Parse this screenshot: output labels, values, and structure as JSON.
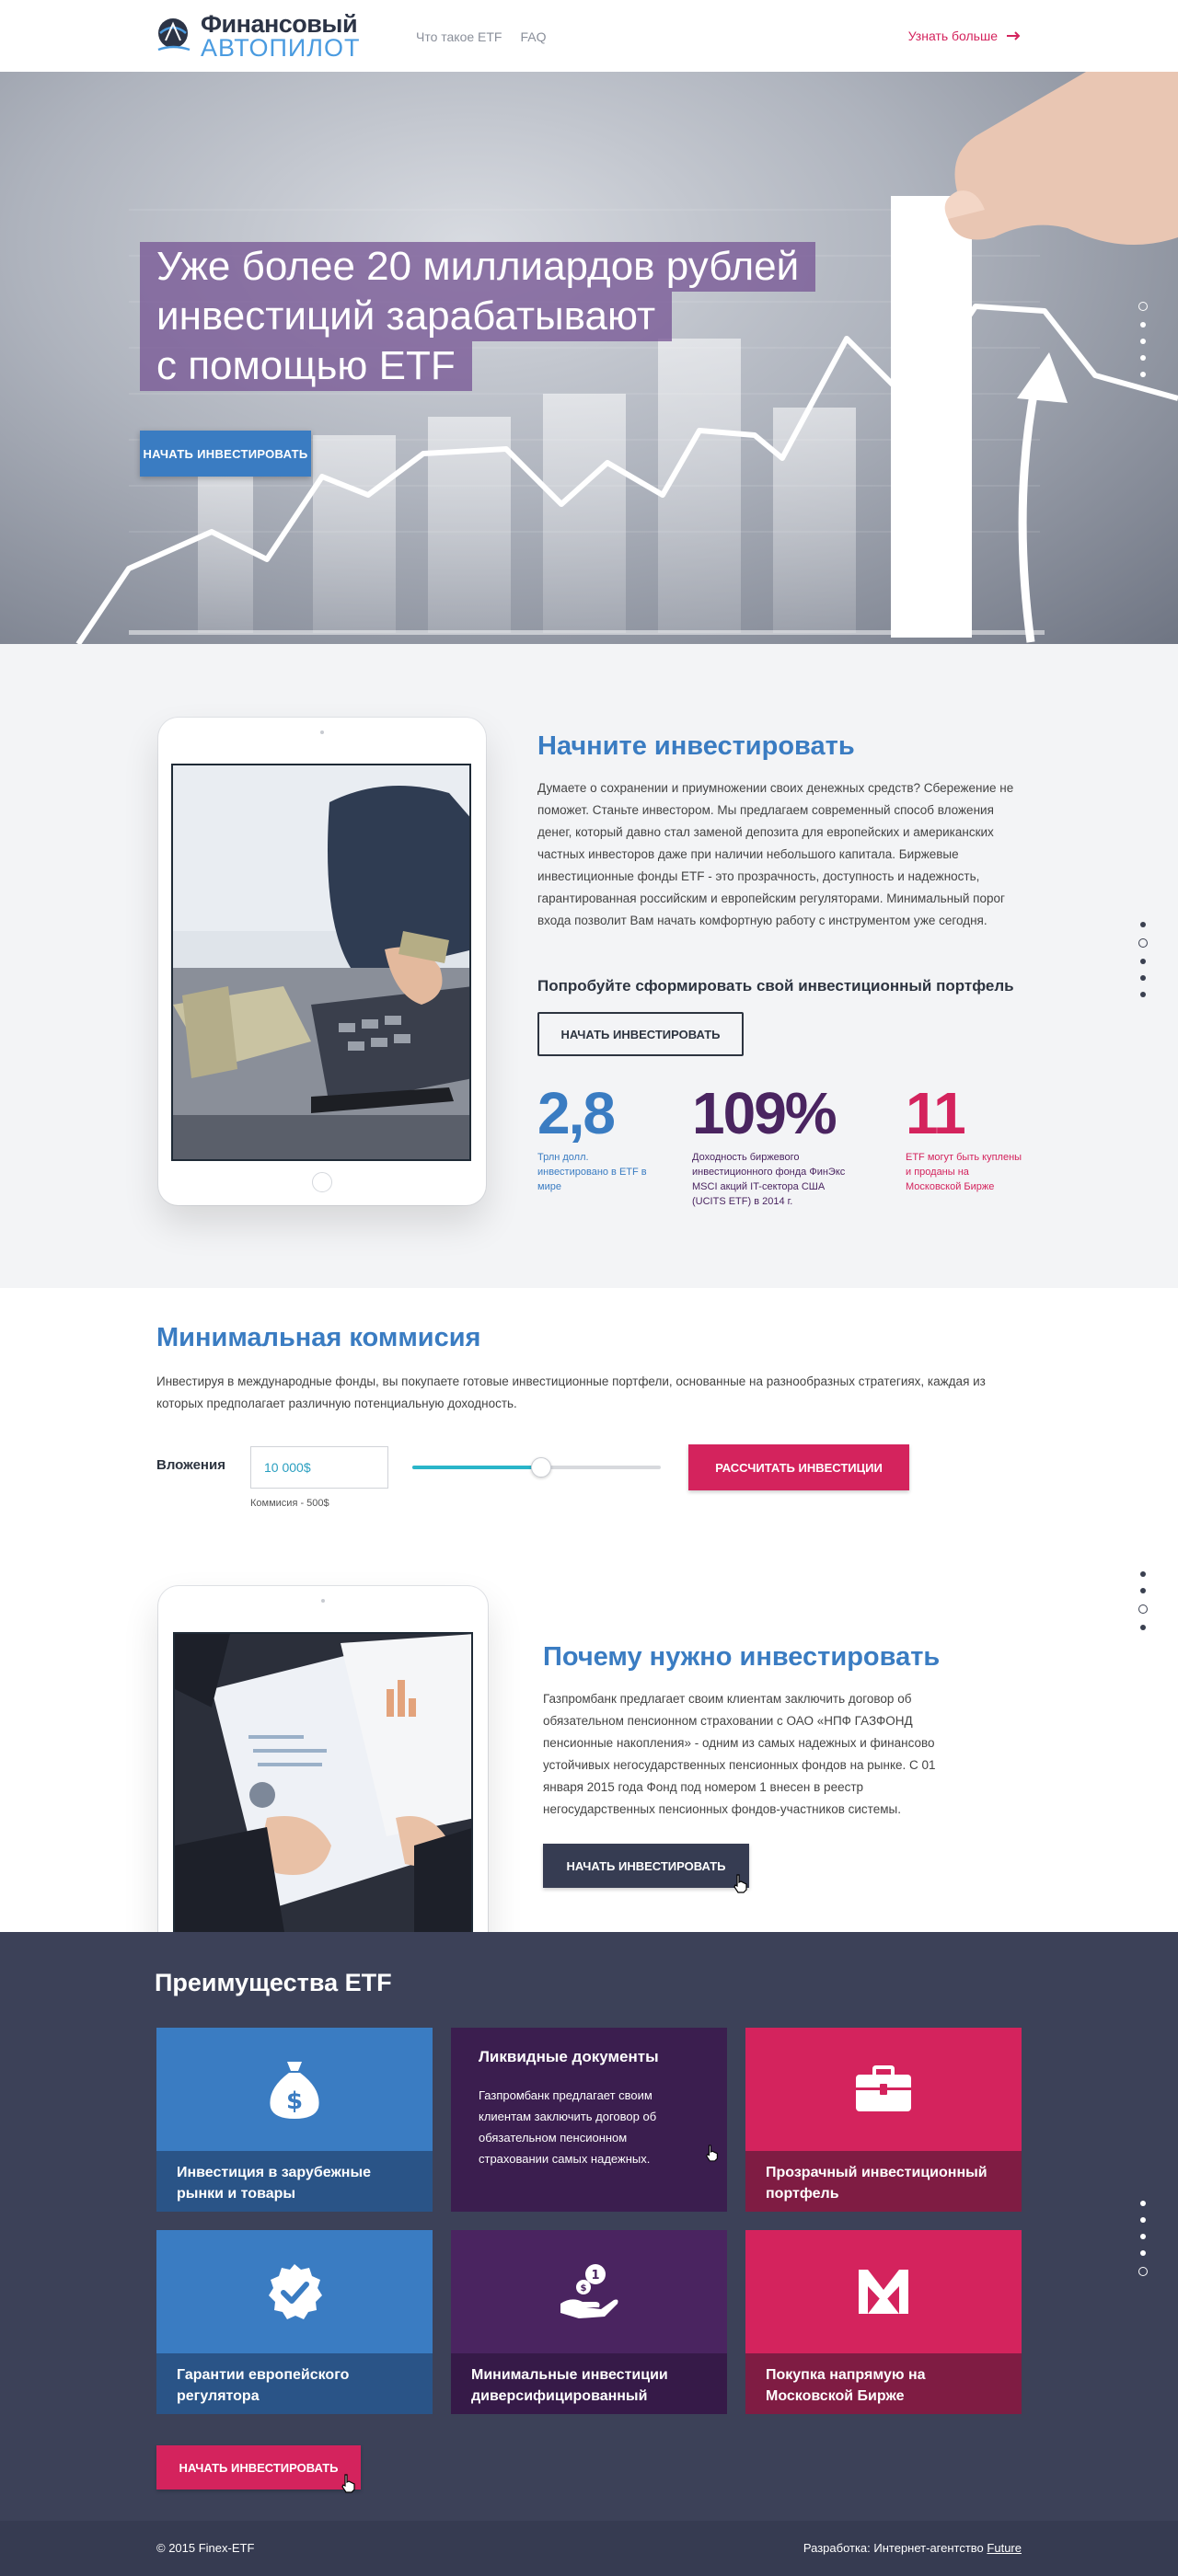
{
  "header": {
    "logo_line1": "Финансовый",
    "logo_line2": "АВТОПИЛОТ",
    "nav": [
      "Что такое ETF",
      "FAQ"
    ],
    "learn_more": "Узнать больше"
  },
  "hero": {
    "title_lines": [
      "Уже более 20 миллиардов рублей",
      "инвестиций зарабатывают",
      "с помощью ETF"
    ],
    "cta": "НАЧАТЬ ИНВЕСТИРОВАТЬ"
  },
  "invest": {
    "title": "Начните инвестировать",
    "paragraph": "Думаете о сохранении и приумножении своих денежных средств? Сбережение не поможет. Станьте инвестором. Мы предлагаем современный способ вложения денег, который давно стал заменой депозита для европейских и американских частных инвесторов даже при наличии  небольшого капитала. Биржевые инвестиционные фонды ETF - это прозрачность, доступность и надежность, гарантированная российским и европейским регуляторами. Минимальный порог входа позволит Вам начать комфортную работу с инструментом уже сегодня.",
    "subtitle": "Попробуйте сформировать свой инвестиционный портфель",
    "cta": "НАЧАТЬ ИНВЕСТИРОВАТЬ",
    "stats": [
      {
        "value": "2,8",
        "text": "Трлн долл. инвестировано в ETF в мире",
        "color": "#3a7cc2"
      },
      {
        "value": "109%",
        "text": "Доходность биржевого инвестиционного фонда ФинЭкс MSCI акций IT-сектора США (UCITS ETF) в 2014 г.",
        "color": "#4a2460"
      },
      {
        "value": "11",
        "text": "ETF могут быть куплены и проданы на Московской Бирже",
        "color": "#d4235d"
      }
    ]
  },
  "commission": {
    "title": "Минимальная коммисия",
    "paragraph": "Инвестируя в международные фонды, вы покупаете готовые инвестиционные портфели, основанные на разнообразных стратегиях, каждая из которых предполагает различную потенциальную доходность.",
    "label": "Вложения",
    "input_value": "10 000$",
    "note": "Коммисия - 500$",
    "slider_level": 0.52,
    "cta": "РАССЧИТАТЬ ИНВЕСТИЦИИ"
  },
  "why": {
    "title": "Почему нужно инвестировать",
    "paragraph": "Газпромбанк предлагает своим клиентам заключить договор об обязательном пенсионном страховании с ОАО «НПФ ГАЗФОНД пенсионные накопления» - одним из самых надежных и финансово устойчивых негосударственных пенсионных фондов на рынке. С 01 января 2015 года Фонд под номером 1 внесен в реестр негосударственных пенсионных фондов-участников системы.",
    "cta": "НАЧАТЬ ИНВЕСТИРОВАТЬ"
  },
  "advantages": {
    "title": "Преимущества ETF",
    "cards": [
      {
        "label": "Инвестиция в зарубежные рынки и товары",
        "icon": "money-bag-icon",
        "color": "#3a7cc2",
        "cap_color": "#2a5487"
      },
      {
        "label": "Ликвидные документы",
        "text": "Газпромбанк предлагает своим клиентам заключить договор об обязательном пенсионном страховании самых надежных.",
        "color": "#3b1e4f"
      },
      {
        "label": "Прозрачный инвестиционный портфель",
        "icon": "briefcase-icon",
        "color": "#d4235d",
        "cap_color": "#7f1c43"
      },
      {
        "label": "Гарантии европейского регулятора",
        "icon": "badge-check-icon",
        "color": "#3a7cc2",
        "cap_color": "#2a5487"
      },
      {
        "label": "Минимальные инвестиции диверсифицированный",
        "icon": "hand-coin-icon",
        "color": "#4a2460",
        "cap_color": "#361a48"
      },
      {
        "label": "Покупка напрямую на Московской Бирже",
        "icon": "moex-icon",
        "color": "#d4235d",
        "cap_color": "#7f1c43"
      }
    ],
    "cta": "НАЧАТЬ ИНВЕСТИРОВАТЬ"
  },
  "footer": {
    "copyright": "© 2015 Finex-ETF",
    "dev_prefix": "Разработка: Интернет-агентство",
    "dev_link": "Future"
  }
}
